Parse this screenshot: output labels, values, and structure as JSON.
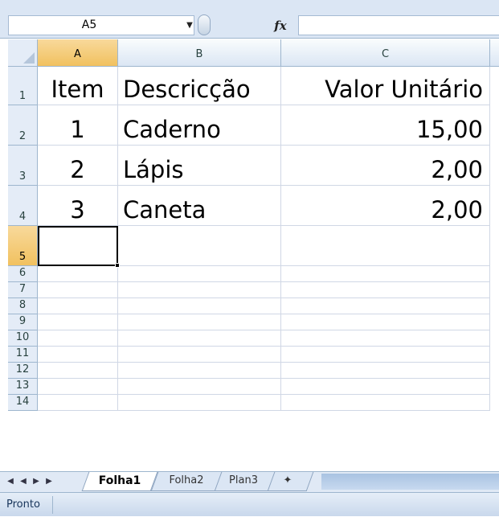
{
  "formula_bar": {
    "name_box": "A5",
    "fx_label": "fx",
    "formula": ""
  },
  "columns": [
    "A",
    "B",
    "C"
  ],
  "rows": [
    "1",
    "2",
    "3",
    "4",
    "5",
    "6",
    "7",
    "8",
    "9",
    "10",
    "11",
    "12",
    "13",
    "14"
  ],
  "cells": {
    "A1": "Item",
    "B1": "Descricção",
    "C1": "Valor Unitário",
    "A2": "1",
    "B2": "Caderno",
    "C2": "15,00",
    "A3": "2",
    "B3": "Lápis",
    "C3": "2,00",
    "A4": "3",
    "B4": "Caneta",
    "C4": "2,00"
  },
  "active_cell": "A5",
  "sheet_tabs": [
    "Folha1",
    "Folha2",
    "Plan3"
  ],
  "active_tab": "Folha1",
  "status_bar": {
    "text": "Pronto"
  },
  "colors": {
    "header_bg": "#dbe6f4",
    "selected_header": "#f1c15f",
    "gridline": "#d0d7e5"
  },
  "icons": {
    "name_box_dropdown": "chevron-down-icon",
    "function": "fx-icon",
    "nav": [
      "first-sheet-icon",
      "prev-sheet-icon",
      "next-sheet-icon",
      "last-sheet-icon"
    ],
    "insert_sheet": "insert-sheet-icon"
  }
}
